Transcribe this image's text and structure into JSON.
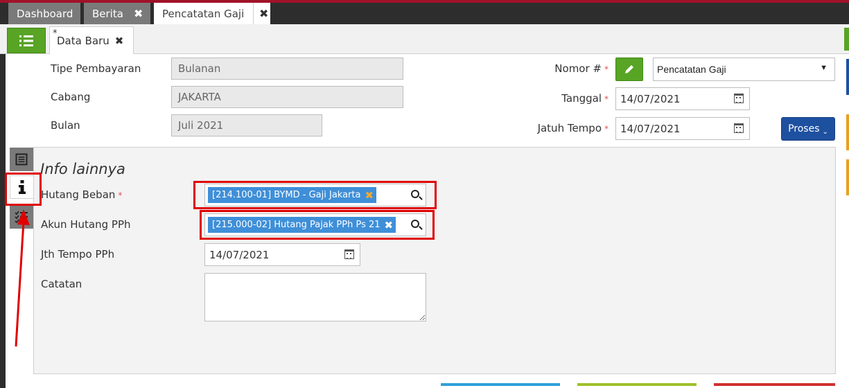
{
  "top_tabs": {
    "dashboard": "Dashboard",
    "berita": "Berita",
    "pencatatan_gaji": "Pencatatan Gaji",
    "close_glyph": "✖"
  },
  "doc_tab": {
    "modified_mark": "*",
    "label": "Data Baru",
    "close_glyph": "✖"
  },
  "form": {
    "tipe_pembayaran": {
      "label": "Tipe Pembayaran",
      "value": "Bulanan"
    },
    "cabang": {
      "label": "Cabang",
      "value": "JAKARTA"
    },
    "bulan": {
      "label": "Bulan",
      "value": "Juli 2021"
    },
    "nomor": {
      "label": "Nomor #",
      "required": "*",
      "value": "Pencatatan Gaji",
      "arrow": "▼"
    },
    "tanggal": {
      "label": "Tanggal",
      "required": "*",
      "value": "14/07/2021"
    },
    "jatuh_tempo": {
      "label": "Jatuh Tempo",
      "required": "*",
      "value": "14/07/2021"
    },
    "proses_button": "Proses",
    "proses_chevron": "⌄"
  },
  "info_panel": {
    "title": "Info lainnya",
    "hutang_beban": {
      "label": "Hutang Beban",
      "required": "*",
      "value": "[214.100-01] BYMD - Gaji Jakarta",
      "remove_glyph": "✖"
    },
    "akun_hutang_pph": {
      "label": "Akun Hutang PPh",
      "value": "[215.000-02] Hutang Pajak PPh Ps 21",
      "remove_glyph": "✖"
    },
    "jth_tempo_pph": {
      "label": "Jth Tempo PPh",
      "value": "14/07/2021"
    },
    "catatan": {
      "label": "Catatan",
      "value": ""
    }
  },
  "colors": {
    "accent_green": "#58a425",
    "primary_blue": "#1e50a0",
    "chip_blue": "#3f8fd8",
    "annotation_red": "#e00000",
    "top_bar_dark": "#2d2d2d"
  }
}
